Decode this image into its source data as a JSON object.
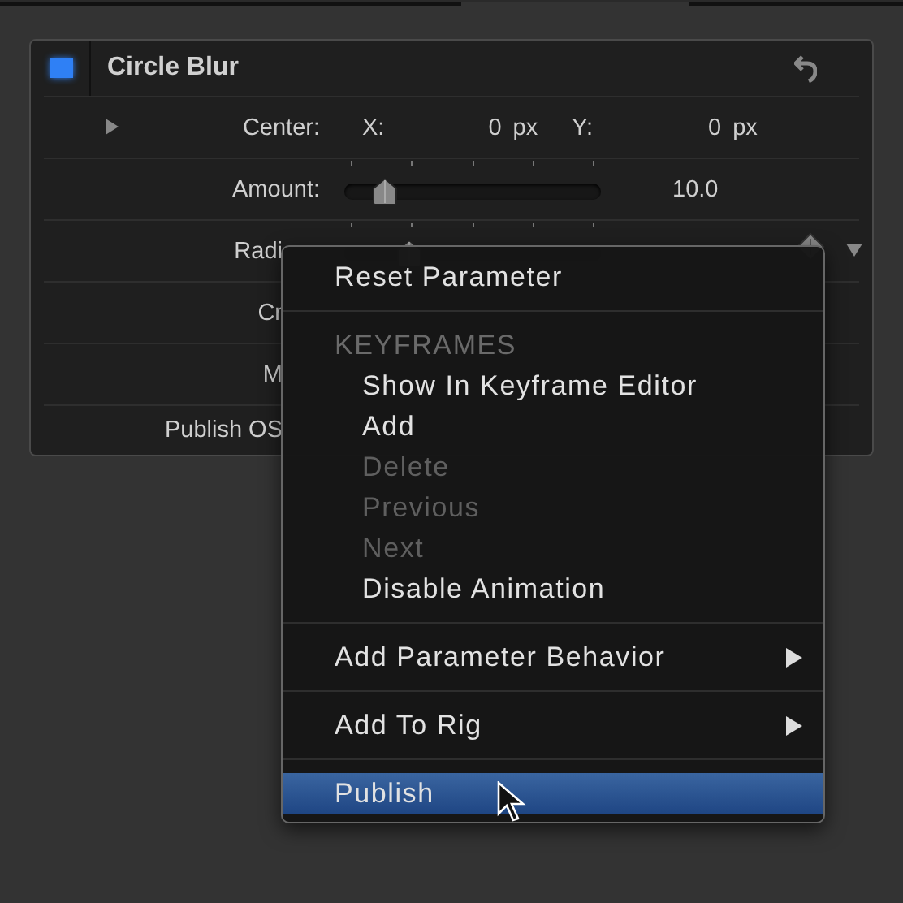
{
  "panel": {
    "title": "Circle Blur",
    "enabled": true,
    "rows": [
      {
        "kind": "point",
        "label": "Center:",
        "expanded": false,
        "x_label": "X:",
        "x_value": "0",
        "x_unit": "px",
        "y_label": "Y:",
        "y_value": "0",
        "y_unit": "px"
      },
      {
        "kind": "slider",
        "label": "Amount:",
        "level": 0.14,
        "value": "10.0"
      },
      {
        "kind": "slider",
        "label": "Radi",
        "covered": true,
        "level": 0.24,
        "keyframe": true
      },
      {
        "kind": "plain",
        "label": "Cr",
        "covered": true
      },
      {
        "kind": "plain",
        "label": "M",
        "covered": true
      },
      {
        "kind": "plain",
        "label": "Publish OS",
        "covered": true
      }
    ]
  },
  "context_menu": {
    "sections": [
      {
        "items": [
          {
            "kind": "action",
            "label": "Reset Parameter",
            "disabled": false,
            "submenu": false,
            "selected": false
          }
        ]
      },
      {
        "items": [
          {
            "kind": "heading",
            "label": "KEYFRAMES"
          },
          {
            "kind": "sub",
            "label": "Show In Keyframe Editor",
            "disabled": false,
            "selected": false
          },
          {
            "kind": "sub",
            "label": "Add",
            "disabled": false,
            "selected": false
          },
          {
            "kind": "sub",
            "label": "Delete",
            "disabled": true,
            "selected": false
          },
          {
            "kind": "sub",
            "label": "Previous",
            "disabled": true,
            "selected": false
          },
          {
            "kind": "sub",
            "label": "Next",
            "disabled": true,
            "selected": false
          },
          {
            "kind": "sub",
            "label": "Disable Animation",
            "disabled": false,
            "selected": false
          }
        ]
      },
      {
        "items": [
          {
            "kind": "action",
            "label": "Add Parameter Behavior",
            "disabled": false,
            "submenu": true,
            "selected": false
          }
        ]
      },
      {
        "items": [
          {
            "kind": "action",
            "label": "Add To Rig",
            "disabled": false,
            "submenu": true,
            "selected": false
          }
        ]
      },
      {
        "items": [
          {
            "kind": "action",
            "label": "Publish",
            "disabled": false,
            "submenu": false,
            "selected": true
          }
        ]
      }
    ]
  }
}
